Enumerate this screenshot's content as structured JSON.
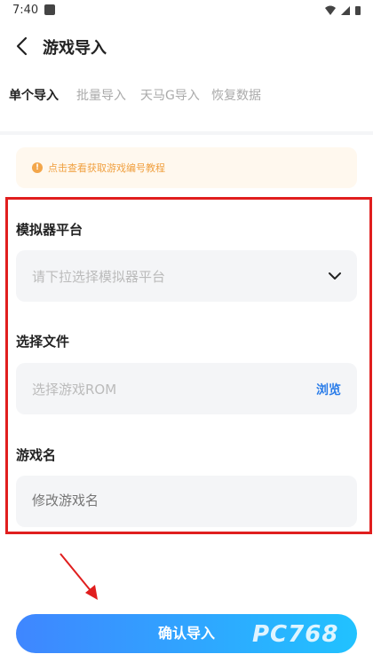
{
  "status": {
    "time": "7:40"
  },
  "header": {
    "title": "游戏导入"
  },
  "tabs": [
    {
      "label": "单个导入",
      "active": true
    },
    {
      "label": "批量导入",
      "active": false
    },
    {
      "label": "天马G导入",
      "active": false
    },
    {
      "label": "恢复数据",
      "active": false
    }
  ],
  "notice": {
    "icon": "info-icon",
    "text": "点击查看获取游戏编号教程"
  },
  "form": {
    "platform": {
      "label": "模拟器平台",
      "placeholder": "请下拉选择模拟器平台"
    },
    "file": {
      "label": "选择文件",
      "placeholder": "选择游戏ROM",
      "browse_label": "浏览"
    },
    "name": {
      "label": "游戏名",
      "placeholder": "修改游戏名"
    }
  },
  "footer": {
    "confirm_label": "确认导入"
  },
  "watermark": {
    "text": "PC768"
  },
  "colors": {
    "accent": "#2b7de9",
    "highlight": "#e01e1e",
    "notice_bg": "#fff8ee"
  }
}
